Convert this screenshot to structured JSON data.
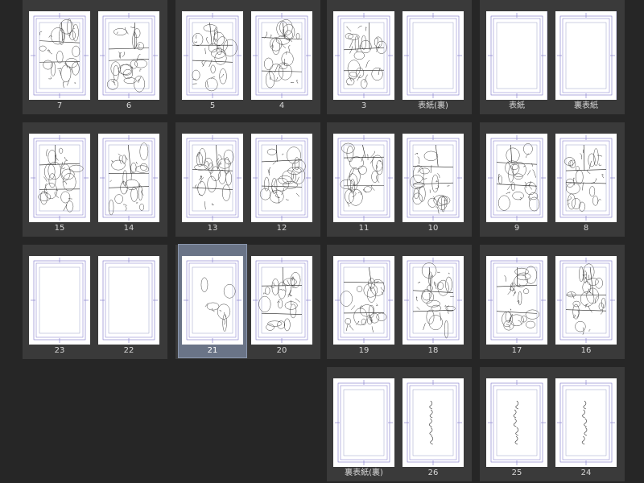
{
  "app": {
    "view": "page-manager-thumbnails"
  },
  "spreads": [
    {
      "id": "s1",
      "left": "7",
      "right": "6",
      "left_type": "sketch",
      "right_type": "sketch"
    },
    {
      "id": "s2",
      "left": "5",
      "right": "4",
      "left_type": "sketch",
      "right_type": "sketch"
    },
    {
      "id": "s3",
      "left": "3",
      "right": "表紙(裏)",
      "left_type": "sketch",
      "right_type": "blank"
    },
    {
      "id": "s4",
      "left": "表紙",
      "right": "裏表紙",
      "left_type": "cover",
      "right_type": "cover"
    },
    {
      "id": "s5",
      "left": "15",
      "right": "14",
      "left_type": "sketch",
      "right_type": "sketch"
    },
    {
      "id": "s6",
      "left": "13",
      "right": "12",
      "left_type": "sketch",
      "right_type": "sketch"
    },
    {
      "id": "s7",
      "left": "11",
      "right": "10",
      "left_type": "sketch",
      "right_type": "sketch"
    },
    {
      "id": "s8",
      "left": "9",
      "right": "8",
      "left_type": "sketch",
      "right_type": "sketch"
    },
    {
      "id": "s9",
      "left": "23",
      "right": "22",
      "left_type": "blank",
      "right_type": "blank"
    },
    {
      "id": "s10",
      "left": "21",
      "right": "20",
      "left_type": "sketch-light",
      "right_type": "sketch"
    },
    {
      "id": "s11",
      "left": "19",
      "right": "18",
      "left_type": "sketch",
      "right_type": "sketch"
    },
    {
      "id": "s12",
      "left": "17",
      "right": "16",
      "left_type": "sketch",
      "right_type": "sketch"
    },
    {
      "id": "s13",
      "left": "裏表紙(裏)",
      "right": "26",
      "left_type": "blank",
      "right_type": "text"
    },
    {
      "id": "s14",
      "left": "25",
      "right": "24",
      "left_type": "text",
      "right_type": "text"
    }
  ],
  "selected_page": "21",
  "colors": {
    "background": "#262626",
    "spread_bg": "#3a3a3a",
    "selection": "#6a7487",
    "guide": "#7b73c8"
  }
}
